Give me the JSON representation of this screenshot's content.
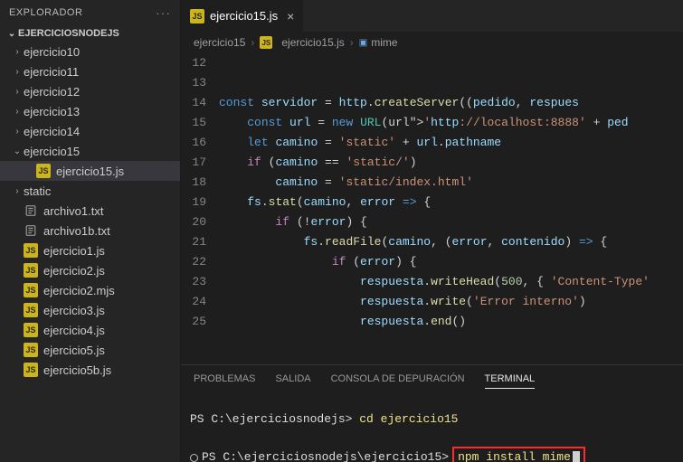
{
  "sidebar": {
    "title": "EXPLORADOR",
    "project": "EJERCICIOSNODEJS",
    "items": [
      {
        "label": "ejercicio10",
        "kind": "folder",
        "open": false,
        "nested": false
      },
      {
        "label": "ejercicio11",
        "kind": "folder",
        "open": false,
        "nested": false
      },
      {
        "label": "ejercicio12",
        "kind": "folder",
        "open": false,
        "nested": false
      },
      {
        "label": "ejercicio13",
        "kind": "folder",
        "open": false,
        "nested": false
      },
      {
        "label": "ejercicio14",
        "kind": "folder",
        "open": false,
        "nested": false
      },
      {
        "label": "ejercicio15",
        "kind": "folder",
        "open": true,
        "nested": false
      },
      {
        "label": "ejercicio15.js",
        "kind": "js",
        "nested": true,
        "selected": true
      },
      {
        "label": "static",
        "kind": "folder",
        "open": false,
        "nested": false
      },
      {
        "label": "archivo1.txt",
        "kind": "txt",
        "nested": false
      },
      {
        "label": "archivo1b.txt",
        "kind": "txt",
        "nested": false
      },
      {
        "label": "ejercicio1.js",
        "kind": "js",
        "nested": false
      },
      {
        "label": "ejercicio2.js",
        "kind": "js",
        "nested": false
      },
      {
        "label": "ejercicio2.mjs",
        "kind": "js",
        "nested": false
      },
      {
        "label": "ejercicio3.js",
        "kind": "js",
        "nested": false
      },
      {
        "label": "ejercicio4.js",
        "kind": "js",
        "nested": false
      },
      {
        "label": "ejercicio5.js",
        "kind": "js",
        "nested": false
      },
      {
        "label": "ejercicio5b.js",
        "kind": "js",
        "nested": false
      }
    ]
  },
  "tab": {
    "filename": "ejercicio15.js"
  },
  "breadcrumb": {
    "segments": [
      "ejercicio15",
      "ejercicio15.js",
      "mime"
    ]
  },
  "code": {
    "lines_start": 11,
    "first_line_gutter_hidden": true,
    "lines": [
      "",
      "",
      "const servidor = http.createServer((pedido, respues",
      "    const url = new URL('http://localhost:8888' + ped",
      "    let camino = 'static' + url.pathname",
      "    if (camino == 'static/')",
      "        camino = 'static/index.html'",
      "    fs.stat(camino, error => {",
      "        if (!error) {",
      "            fs.readFile(camino, (error, contenido) => {",
      "                if (error) {",
      "                    respuesta.writeHead(500, { 'Content-Type'",
      "                    respuesta.write('Error interno')",
      "                    respuesta.end()",
      ""
    ],
    "visible_last_line": 25
  },
  "panel": {
    "tabs": [
      "PROBLEMAS",
      "SALIDA",
      "CONSOLA DE DEPURACIÓN",
      "TERMINAL"
    ],
    "active_tab": "TERMINAL",
    "terminal": {
      "line1_prompt": "PS ",
      "line1_path": "C:\\ejerciciosnodejs",
      "line1_cmd": "cd ejercicio15",
      "line2_prompt": "PS ",
      "line2_path": "C:\\ejerciciosnodejs\\ejercicio15",
      "line2_cmd": "npm install mime"
    }
  }
}
